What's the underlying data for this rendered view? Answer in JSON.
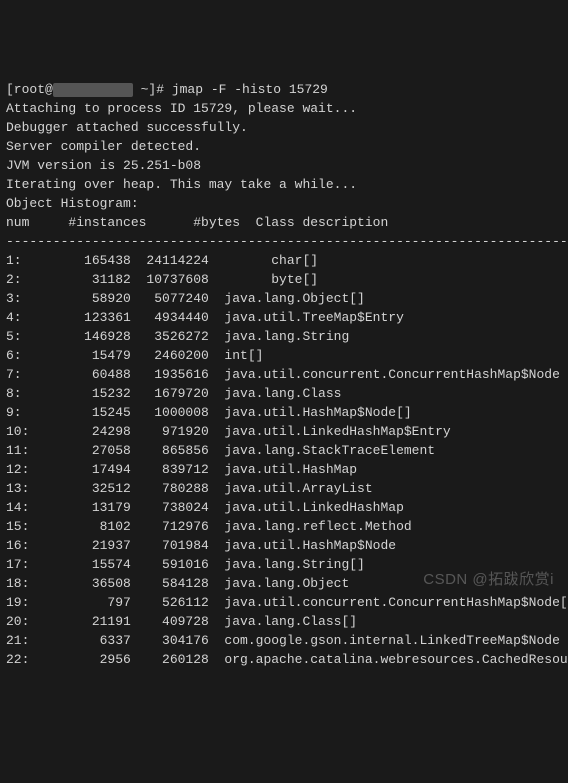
{
  "prompt": {
    "userhost": "[root@",
    "blurred": "        ",
    "path": " ~]# ",
    "command": "jmap -F -histo 15729"
  },
  "messages": [
    "Attaching to process ID 15729, please wait...",
    "Debugger attached successfully.",
    "Server compiler detected.",
    "JVM version is 25.251-b08",
    "Iterating over heap. This may take a while...",
    "Object Histogram:",
    ""
  ],
  "header": "num \t#instances\t#bytes\tClass description",
  "divider": "--------------------------------------------------------------------------",
  "rows": [
    {
      "n": "1:",
      "inst": "165438",
      "bytes": "24114224",
      "desc": "char[]"
    },
    {
      "n": "2:",
      "inst": "31182",
      "bytes": "10737608",
      "desc": "byte[]"
    },
    {
      "n": "3:",
      "inst": "58920",
      "bytes": "5077240",
      "desc": "java.lang.Object[]"
    },
    {
      "n": "4:",
      "inst": "123361",
      "bytes": "4934440",
      "desc": "java.util.TreeMap$Entry"
    },
    {
      "n": "5:",
      "inst": "146928",
      "bytes": "3526272",
      "desc": "java.lang.String"
    },
    {
      "n": "6:",
      "inst": "15479",
      "bytes": "2460200",
      "desc": "int[]"
    },
    {
      "n": "7:",
      "inst": "60488",
      "bytes": "1935616",
      "desc": "java.util.concurrent.ConcurrentHashMap$Node"
    },
    {
      "n": "8:",
      "inst": "15232",
      "bytes": "1679720",
      "desc": "java.lang.Class"
    },
    {
      "n": "9:",
      "inst": "15245",
      "bytes": "1000008",
      "desc": "java.util.HashMap$Node[]"
    },
    {
      "n": "10:",
      "inst": "24298",
      "bytes": "971920",
      "desc": "java.util.LinkedHashMap$Entry"
    },
    {
      "n": "11:",
      "inst": "27058",
      "bytes": "865856",
      "desc": "java.lang.StackTraceElement"
    },
    {
      "n": "12:",
      "inst": "17494",
      "bytes": "839712",
      "desc": "java.util.HashMap"
    },
    {
      "n": "13:",
      "inst": "32512",
      "bytes": "780288",
      "desc": "java.util.ArrayList"
    },
    {
      "n": "14:",
      "inst": "13179",
      "bytes": "738024",
      "desc": "java.util.LinkedHashMap"
    },
    {
      "n": "15:",
      "inst": "8102",
      "bytes": "712976",
      "desc": "java.lang.reflect.Method"
    },
    {
      "n": "16:",
      "inst": "21937",
      "bytes": "701984",
      "desc": "java.util.HashMap$Node"
    },
    {
      "n": "17:",
      "inst": "15574",
      "bytes": "591016",
      "desc": "java.lang.String[]"
    },
    {
      "n": "18:",
      "inst": "36508",
      "bytes": "584128",
      "desc": "java.lang.Object"
    },
    {
      "n": "19:",
      "inst": "797",
      "bytes": "526112",
      "desc": "java.util.concurrent.ConcurrentHashMap$Node[]"
    },
    {
      "n": "20:",
      "inst": "21191",
      "bytes": "409728",
      "desc": "java.lang.Class[]"
    },
    {
      "n": "21:",
      "inst": "6337",
      "bytes": "304176",
      "desc": "com.google.gson.internal.LinkedTreeMap$Node"
    },
    {
      "n": "22:",
      "inst": "2956",
      "bytes": "260128",
      "desc": "org.apache.catalina.webresources.CachedResource"
    }
  ],
  "watermark": "CSDN @拓跋欣赏i"
}
